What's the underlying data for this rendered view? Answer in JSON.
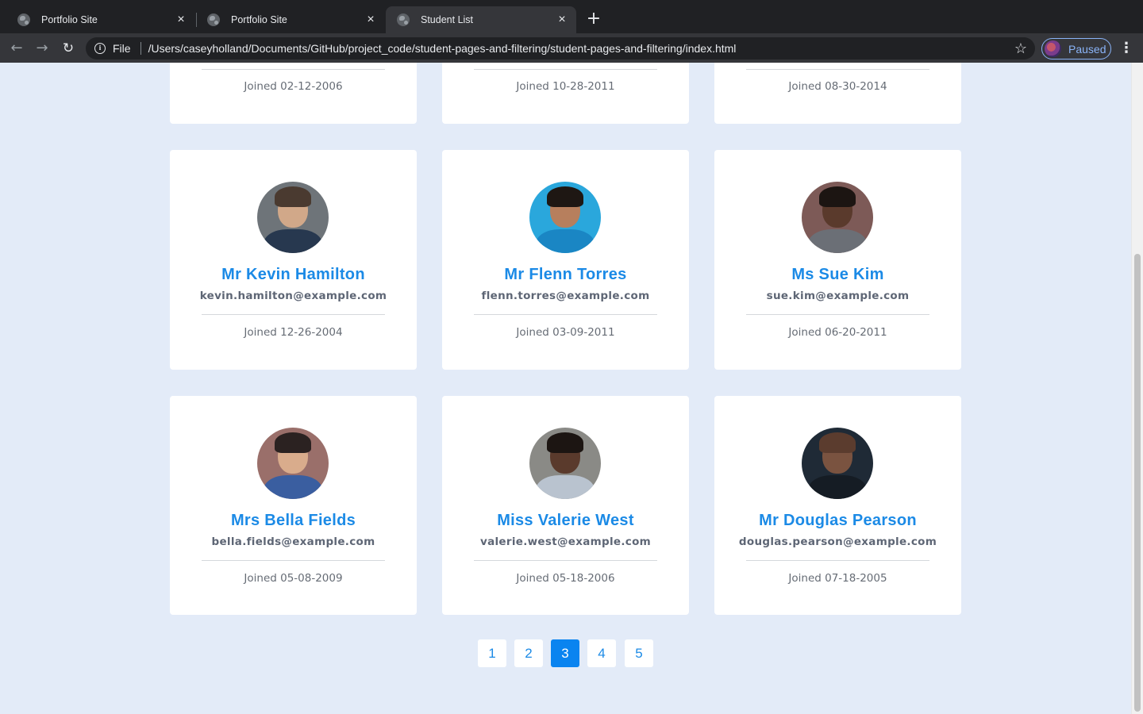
{
  "browser": {
    "tabs": [
      {
        "title": "Portfolio Site",
        "active": false
      },
      {
        "title": "Portfolio Site",
        "active": false
      },
      {
        "title": "Student List",
        "active": true
      }
    ],
    "close_glyph": "×",
    "new_tab_glyph": "+",
    "back_glyph": "←",
    "forward_glyph": "→",
    "reload_glyph": "↻",
    "scheme_label": "File",
    "url": "/Users/caseyholland/Documents/GitHub/project_code/student-pages-and-filtering/student-pages-and-filtering/index.html",
    "star_glyph": "☆",
    "profile_label": "Paused",
    "menu_glyph": "⋮",
    "info_glyph": "i"
  },
  "top_row": [
    {
      "joined": "Joined 02-12-2006"
    },
    {
      "joined": "Joined 10-28-2011"
    },
    {
      "joined": "Joined 08-30-2014"
    }
  ],
  "students": [
    {
      "name": "Mr Kevin Hamilton",
      "email": "kevin.hamilton@example.com",
      "joined": "Joined 12-26-2004",
      "photo": {
        "bg": "#6e7479",
        "skin": "#d1a889",
        "hair": "#4a3a30",
        "shirt": "#27384f"
      }
    },
    {
      "name": "Mr Flenn Torres",
      "email": "flenn.torres@example.com",
      "joined": "Joined 03-09-2011",
      "photo": {
        "bg": "#2aa7dc",
        "skin": "#b77f5d",
        "hair": "#1e1713",
        "shirt": "#1a86c4"
      }
    },
    {
      "name": "Ms Sue Kim",
      "email": "sue.kim@example.com",
      "joined": "Joined 06-20-2011",
      "photo": {
        "bg": "#7d5a57",
        "skin": "#5a3a2c",
        "hair": "#1c1512",
        "shirt": "#6b6f76"
      }
    },
    {
      "name": "Mrs Bella Fields",
      "email": "bella.fields@example.com",
      "joined": "Joined 05-08-2009",
      "photo": {
        "bg": "#9a6f6a",
        "skin": "#d9ac8c",
        "hair": "#2b2221",
        "shirt": "#3a5ea0"
      }
    },
    {
      "name": "Miss Valerie West",
      "email": "valerie.west@example.com",
      "joined": "Joined 05-18-2006",
      "photo": {
        "bg": "#8a8a86",
        "skin": "#5a3a2c",
        "hair": "#1c1512",
        "shirt": "#b9c3cf"
      }
    },
    {
      "name": "Mr Douglas Pearson",
      "email": "douglas.pearson@example.com",
      "joined": "Joined 07-18-2005",
      "photo": {
        "bg": "#1f2a36",
        "skin": "#7a5340",
        "hair": "#5b3c2e",
        "shirt": "#151c24"
      }
    }
  ],
  "pagination": {
    "pages": [
      "1",
      "2",
      "3",
      "4",
      "5"
    ],
    "current": "3"
  }
}
